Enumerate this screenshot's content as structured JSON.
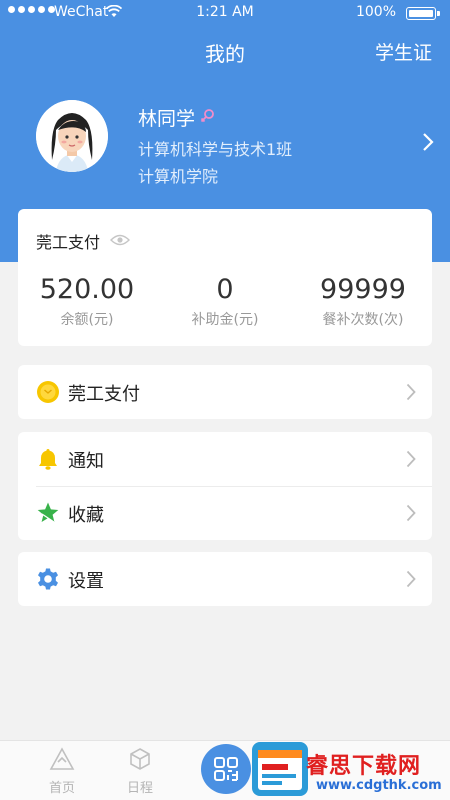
{
  "status_bar": {
    "carrier": "WeChat",
    "time": "1:21 AM",
    "battery": "100%"
  },
  "nav": {
    "title": "我的",
    "right_action": "学生证"
  },
  "profile": {
    "name": "林同学",
    "gender_icon": "female-icon",
    "major_class": "计算机科学与技术1班",
    "college": "计算机学院"
  },
  "payment_card": {
    "title": "莞工支付",
    "stats": [
      {
        "value": "520.00",
        "label": "余额(元)"
      },
      {
        "value": "0",
        "label": "补助金(元)"
      },
      {
        "value": "99999",
        "label": "餐补次数(次)"
      }
    ]
  },
  "menu": {
    "pay": {
      "label": "莞工支付",
      "icon": "coin-icon"
    },
    "notify": {
      "label": "通知",
      "icon": "bell-icon"
    },
    "favorite": {
      "label": "收藏",
      "icon": "star-icon"
    },
    "settings": {
      "label": "设置",
      "icon": "gear-icon"
    }
  },
  "tabbar": {
    "home": "首页",
    "schedule": "日程"
  },
  "watermark": {
    "text": "睿思下载网",
    "url": "www.cdgthk.com"
  },
  "colors": {
    "primary": "#4a90e2",
    "background": "#f2f2f2",
    "coin": "#f7c600",
    "bell": "#f7c600",
    "star": "#38b24a",
    "gear": "#4a90e2"
  }
}
